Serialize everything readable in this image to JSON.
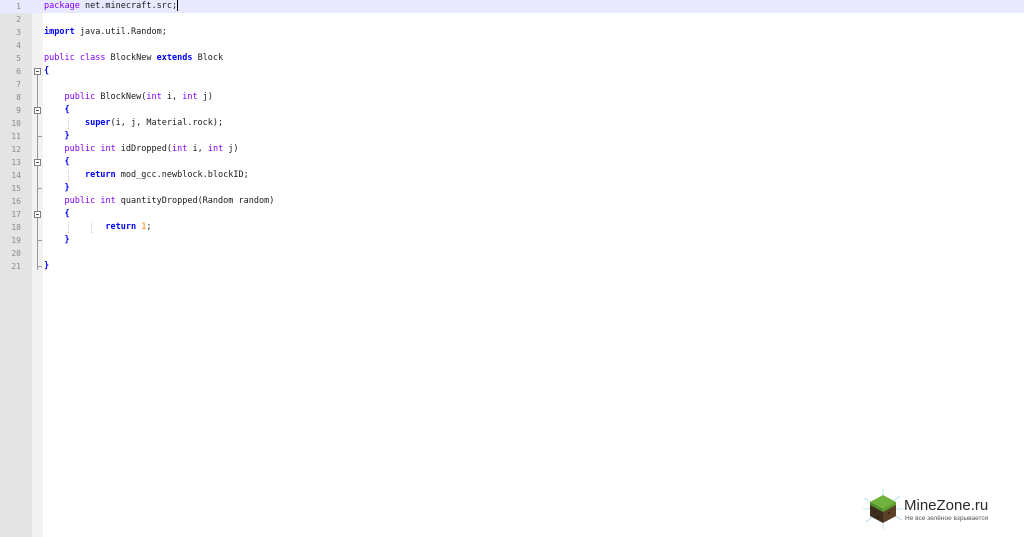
{
  "editor": {
    "language_colors": {
      "keyword": "#0000ff",
      "type_keyword": "#8000ff",
      "number": "#ff8000",
      "current_line": "#e8e8ff"
    },
    "lines": [
      {
        "num": "1",
        "tokens": [
          {
            "t": "kw2",
            "v": "package"
          },
          {
            "t": "plain",
            "v": " net.minecraft.src;"
          }
        ]
      },
      {
        "num": "2",
        "tokens": []
      },
      {
        "num": "3",
        "tokens": [
          {
            "t": "kw",
            "v": "import"
          },
          {
            "t": "plain",
            "v": " java.util.Random;"
          }
        ]
      },
      {
        "num": "4",
        "tokens": []
      },
      {
        "num": "5",
        "tokens": [
          {
            "t": "kw2",
            "v": "public"
          },
          {
            "t": "plain",
            "v": " "
          },
          {
            "t": "kw2",
            "v": "class"
          },
          {
            "t": "plain",
            "v": " BlockNew "
          },
          {
            "t": "kw",
            "v": "extends"
          },
          {
            "t": "plain",
            "v": " Block"
          }
        ]
      },
      {
        "num": "6",
        "tokens": [
          {
            "t": "kw",
            "v": "{"
          }
        ]
      },
      {
        "num": "7",
        "tokens": []
      },
      {
        "num": "8",
        "tokens": [
          {
            "t": "plain",
            "v": "    "
          },
          {
            "t": "kw2",
            "v": "public"
          },
          {
            "t": "plain",
            "v": " BlockNew("
          },
          {
            "t": "kw2",
            "v": "int"
          },
          {
            "t": "plain",
            "v": " i, "
          },
          {
            "t": "kw2",
            "v": "int"
          },
          {
            "t": "plain",
            "v": " j)"
          }
        ]
      },
      {
        "num": "9",
        "tokens": [
          {
            "t": "plain",
            "v": "    "
          },
          {
            "t": "kw",
            "v": "{"
          }
        ]
      },
      {
        "num": "10",
        "tokens": [
          {
            "t": "plain",
            "v": "        "
          },
          {
            "t": "kw",
            "v": "super"
          },
          {
            "t": "plain",
            "v": "(i, j, Material.rock);"
          }
        ]
      },
      {
        "num": "11",
        "tokens": [
          {
            "t": "plain",
            "v": "    "
          },
          {
            "t": "kw",
            "v": "}"
          }
        ]
      },
      {
        "num": "12",
        "tokens": [
          {
            "t": "plain",
            "v": "    "
          },
          {
            "t": "kw2",
            "v": "public"
          },
          {
            "t": "plain",
            "v": " "
          },
          {
            "t": "kw2",
            "v": "int"
          },
          {
            "t": "plain",
            "v": " idDropped("
          },
          {
            "t": "kw2",
            "v": "int"
          },
          {
            "t": "plain",
            "v": " i, "
          },
          {
            "t": "kw2",
            "v": "int"
          },
          {
            "t": "plain",
            "v": " j)"
          }
        ]
      },
      {
        "num": "13",
        "tokens": [
          {
            "t": "plain",
            "v": "    "
          },
          {
            "t": "kw",
            "v": "{"
          }
        ]
      },
      {
        "num": "14",
        "tokens": [
          {
            "t": "plain",
            "v": "        "
          },
          {
            "t": "kw",
            "v": "return"
          },
          {
            "t": "plain",
            "v": " mod_gcc.newblock.blockID;"
          }
        ]
      },
      {
        "num": "15",
        "tokens": [
          {
            "t": "plain",
            "v": "    "
          },
          {
            "t": "kw",
            "v": "}"
          }
        ]
      },
      {
        "num": "16",
        "tokens": [
          {
            "t": "plain",
            "v": "    "
          },
          {
            "t": "kw2",
            "v": "public"
          },
          {
            "t": "plain",
            "v": " "
          },
          {
            "t": "kw2",
            "v": "int"
          },
          {
            "t": "plain",
            "v": " quantityDropped(Random random)"
          }
        ]
      },
      {
        "num": "17",
        "tokens": [
          {
            "t": "plain",
            "v": "    "
          },
          {
            "t": "kw",
            "v": "{"
          }
        ]
      },
      {
        "num": "18",
        "tokens": [
          {
            "t": "plain",
            "v": "            "
          },
          {
            "t": "kw",
            "v": "return"
          },
          {
            "t": "plain",
            "v": " "
          },
          {
            "t": "num",
            "v": "1"
          },
          {
            "t": "plain",
            "v": ";"
          }
        ]
      },
      {
        "num": "19",
        "tokens": [
          {
            "t": "plain",
            "v": "    "
          },
          {
            "t": "kw",
            "v": "}"
          }
        ]
      },
      {
        "num": "20",
        "tokens": []
      },
      {
        "num": "21",
        "tokens": [
          {
            "t": "kw",
            "v": "}"
          }
        ]
      }
    ]
  },
  "watermark": {
    "title": "MineZone.ru",
    "subtitle": "Не все зелёное взрывается",
    "logo_icon": "grass-block-icon"
  }
}
